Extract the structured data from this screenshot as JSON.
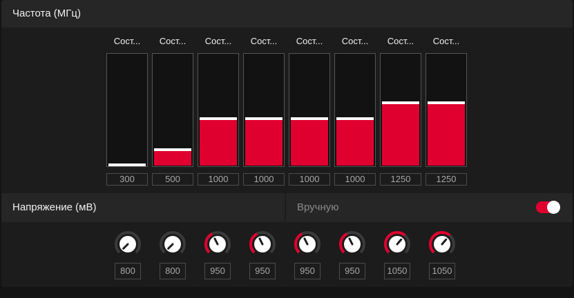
{
  "frequency": {
    "title": "Частота (МГц)",
    "states": [
      {
        "label": "Сост...",
        "value": "300",
        "level": 0.0
      },
      {
        "label": "Сост...",
        "value": "500",
        "level": 0.14
      },
      {
        "label": "Сост...",
        "value": "1000",
        "level": 0.42
      },
      {
        "label": "Сост...",
        "value": "1000",
        "level": 0.42
      },
      {
        "label": "Сост...",
        "value": "1000",
        "level": 0.42
      },
      {
        "label": "Сост...",
        "value": "1000",
        "level": 0.42
      },
      {
        "label": "Сост...",
        "value": "1250",
        "level": 0.56
      },
      {
        "label": "Сост...",
        "value": "1250",
        "level": 0.56
      }
    ]
  },
  "voltage": {
    "title": "Напряжение (мВ)",
    "manual_label": "Вручную",
    "manual_enabled": true,
    "states": [
      {
        "value": "800",
        "level": 0.0
      },
      {
        "value": "800",
        "level": 0.0
      },
      {
        "value": "950",
        "level": 0.4
      },
      {
        "value": "950",
        "level": 0.4
      },
      {
        "value": "950",
        "level": 0.4
      },
      {
        "value": "950",
        "level": 0.4
      },
      {
        "value": "1050",
        "level": 0.65
      },
      {
        "value": "1050",
        "level": 0.65
      }
    ]
  },
  "colors": {
    "accent": "#e0002f",
    "track": "#3a3a3a",
    "handle": "#ffffff"
  }
}
